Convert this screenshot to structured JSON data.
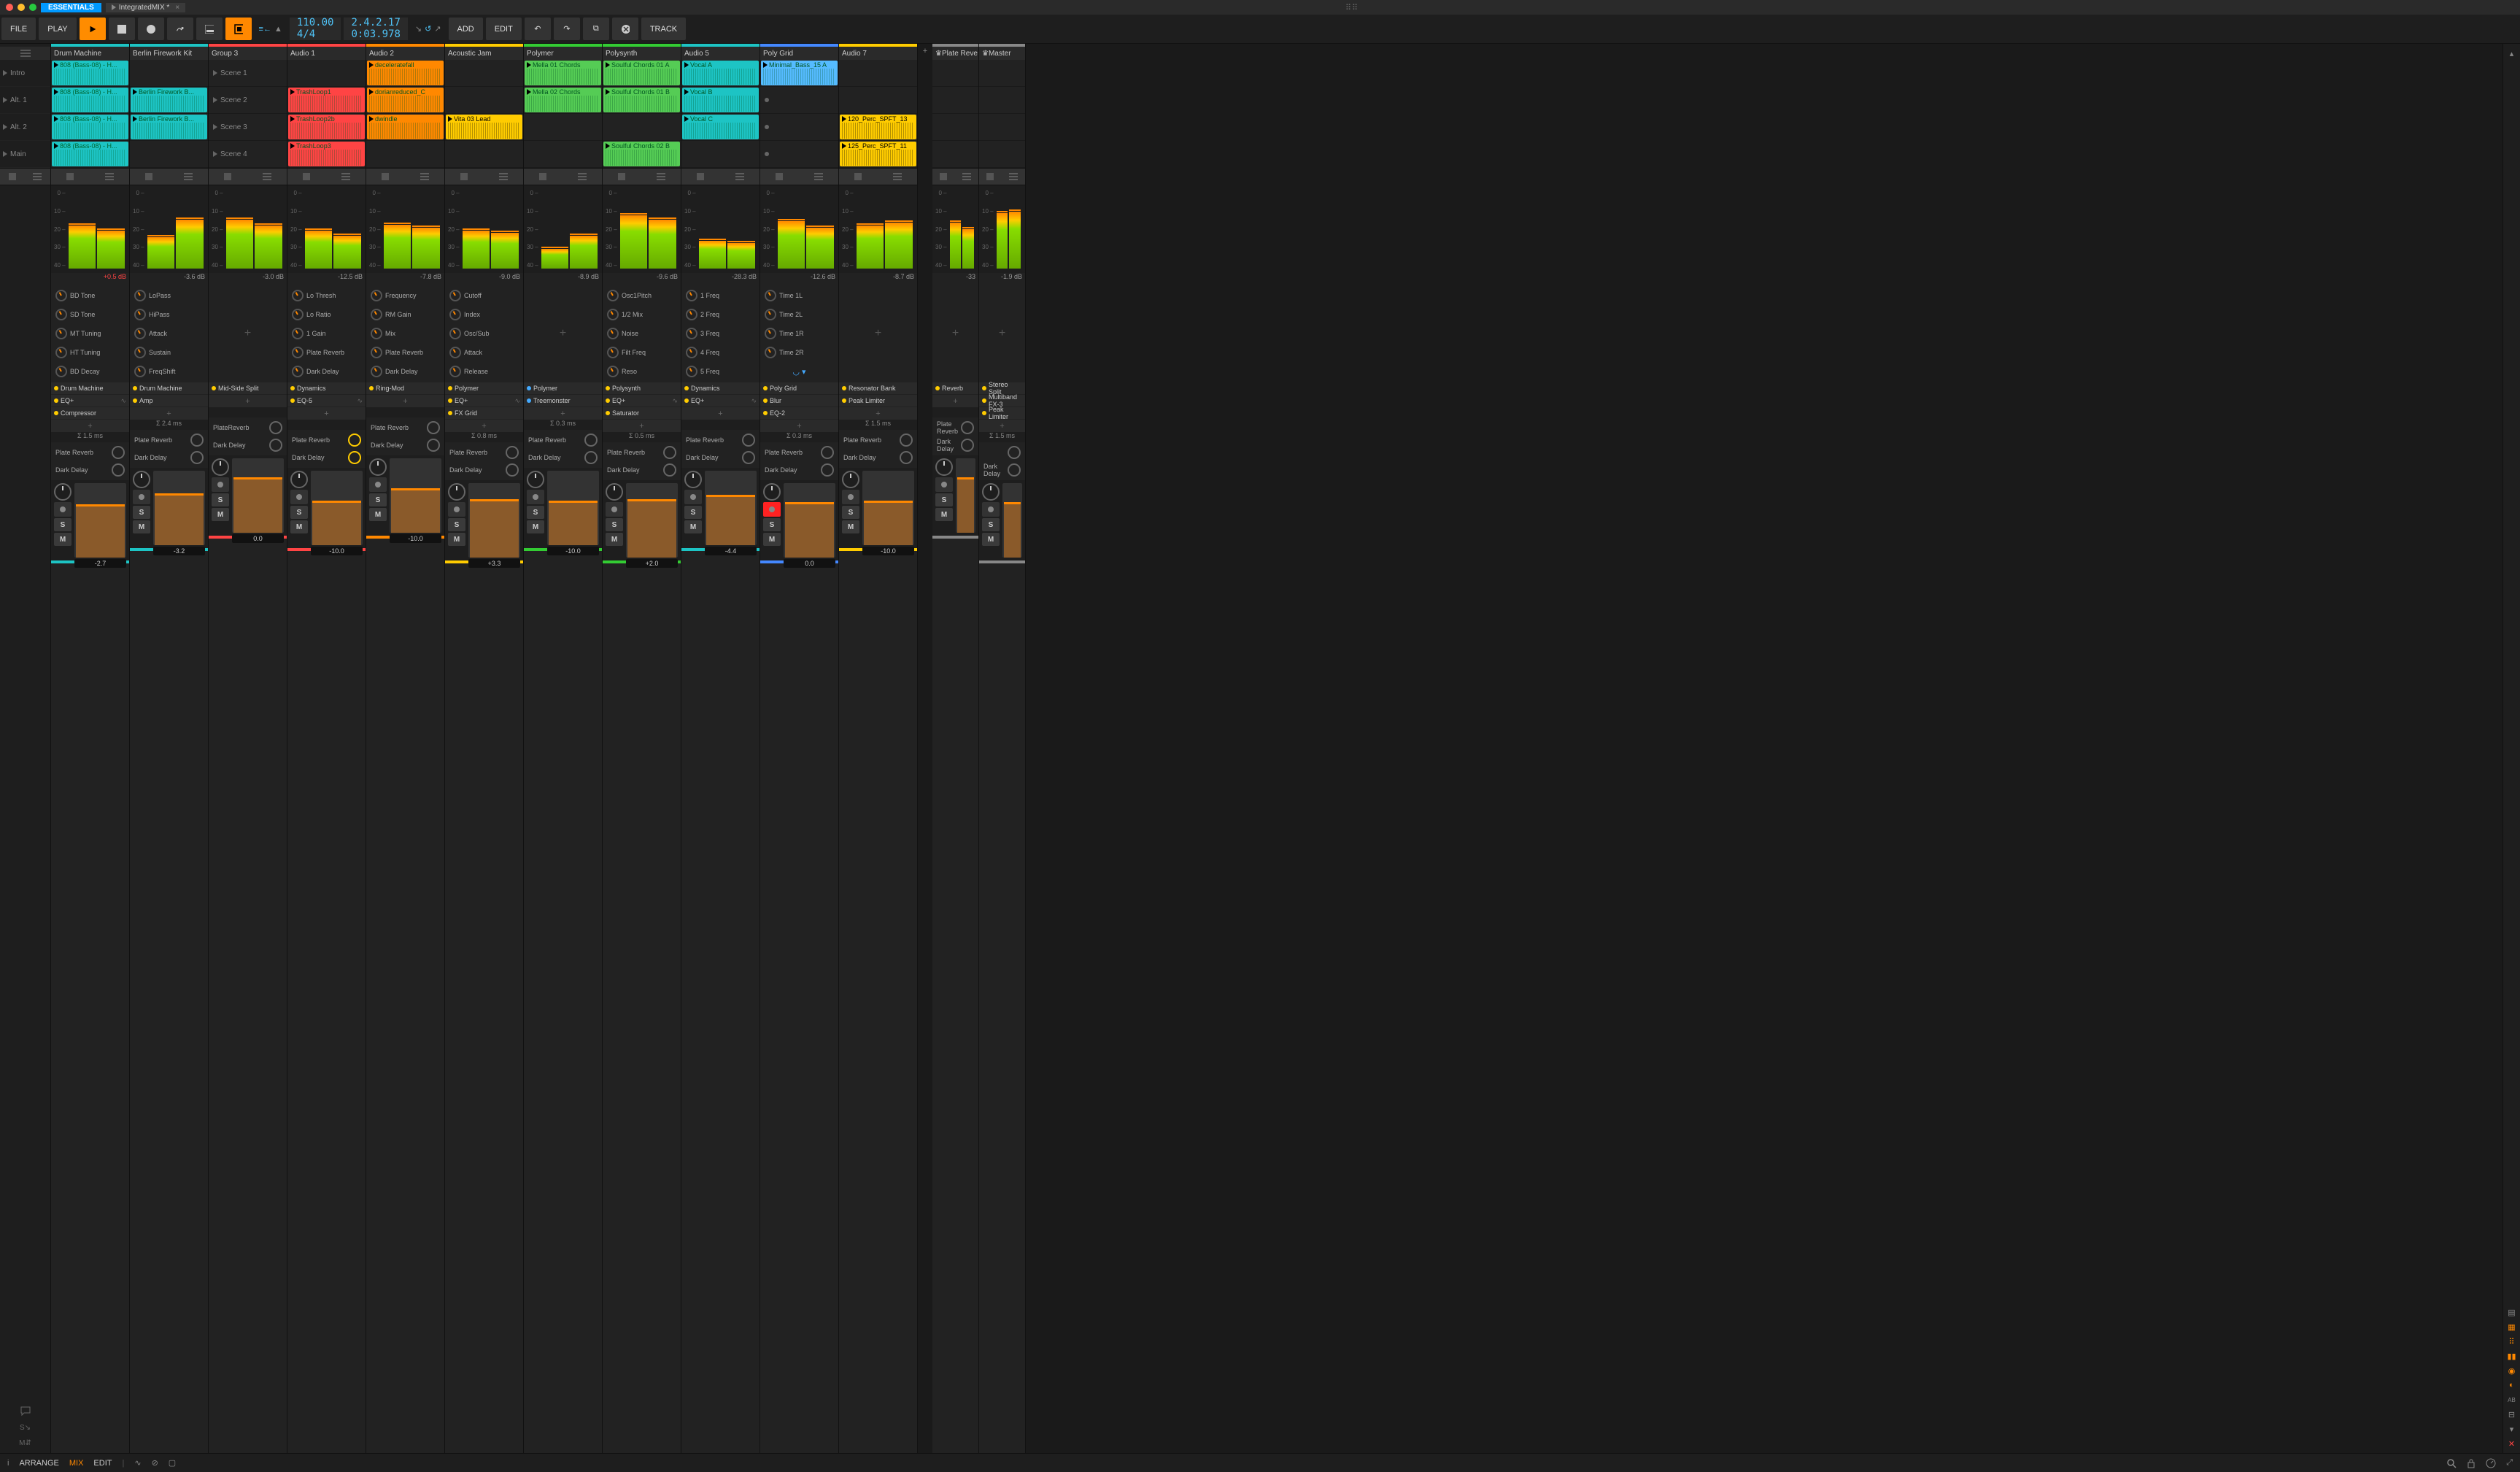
{
  "title_bar": {
    "app_tag": "ESSENTIALS",
    "doc": "IntegratedMIX *"
  },
  "toolbar": {
    "file": "FILE",
    "play": "PLAY",
    "add": "ADD",
    "edit": "EDIT",
    "track": "TRACK",
    "tempo": "110.00",
    "sig": "4/4",
    "pos": "2.4.2.17",
    "time": "0:03.978"
  },
  "scenes": [
    "Intro",
    "Alt. 1",
    "Alt. 2",
    "Main"
  ],
  "tracks": [
    {
      "name": "Drum Machine",
      "color": "#1dc4c4",
      "db": "+0.5 dB",
      "db_red": true,
      "meters": [
        55,
        48
      ],
      "clips": [
        {
          "label": "808 (Bass-08) - H...",
          "bg": "#1dc4c4",
          "fg": "#063"
        },
        {
          "label": "808 (Bass-08) - H...",
          "bg": "#1dc4c4",
          "fg": "#063"
        },
        {
          "label": "808 (Bass-08) - H...",
          "bg": "#1dc4c4",
          "fg": "#063"
        },
        {
          "label": "808 (Bass-08) - H...",
          "bg": "#1dc4c4",
          "fg": "#063"
        }
      ],
      "knobs": [
        "BD Tone",
        "SD Tone",
        "MT Tuning",
        "HT Tuning",
        "BD Decay"
      ],
      "devices": [
        {
          "n": "Drum Machine"
        },
        {
          "n": "EQ+",
          "w": true
        },
        {
          "n": "Compressor"
        }
      ],
      "latency": "Σ 1.5 ms",
      "sends": [
        "Plate Reverb",
        "Dark Delay"
      ],
      "send_on": [
        false,
        false
      ],
      "fader": 72,
      "val": "-2.7"
    },
    {
      "name": "Berlin Firework Kit",
      "color": "#1dc4c4",
      "db": "-3.6 dB",
      "meters": [
        40,
        62
      ],
      "clips": [
        null,
        {
          "label": "Berlin Firework B...",
          "bg": "#1dc4c4"
        },
        {
          "label": "Berlin Firework B...",
          "bg": "#1dc4c4"
        },
        null
      ],
      "knobs": [
        "LoPass",
        "HiPass",
        "Attack",
        "Sustain",
        "FreqShift"
      ],
      "devices": [
        {
          "n": "Drum Machine"
        },
        {
          "n": "Amp"
        }
      ],
      "add_dev": true,
      "latency": "Σ 2.4 ms",
      "sends": [
        "Plate Reverb",
        "Dark Delay"
      ],
      "send_on": [
        false,
        false
      ],
      "fader": 70,
      "val": "-3.2"
    },
    {
      "name": "Group 3",
      "color": "#f44",
      "db": "-3.0 dB",
      "is_group": true,
      "meters": [
        62,
        55
      ],
      "scene_labels": [
        "Scene 1",
        "Scene 2",
        "Scene 3",
        "Scene 4"
      ],
      "knobs": [],
      "devices": [
        {
          "n": "Mid-Side Split"
        }
      ],
      "add_dev": true,
      "sends": [
        "PlateReverb",
        "Dark Delay"
      ],
      "send_on": [
        false,
        false
      ],
      "fader": 75,
      "val": "0.0"
    },
    {
      "name": "Audio 1",
      "color": "#f44",
      "db": "-12.5 dB",
      "meters": [
        48,
        42
      ],
      "clips": [
        null,
        {
          "label": "TrashLoop1",
          "bg": "#f44"
        },
        {
          "label": "TrashLoop2b",
          "bg": "#f44"
        },
        {
          "label": "TrashLoop3",
          "bg": "#f44"
        }
      ],
      "knobs": [
        "Lo Thresh",
        "Lo Ratio",
        "1 Gain",
        "Plate Reverb",
        "Dark Delay"
      ],
      "devices": [
        {
          "n": "Dynamics"
        },
        {
          "n": "EQ-5",
          "w": true
        }
      ],
      "add_dev": true,
      "sends": [
        "Plate Reverb",
        "Dark Delay"
      ],
      "send_on": [
        true,
        true
      ],
      "fader": 60,
      "val": "-10.0"
    },
    {
      "name": "Audio 2",
      "color": "#f80",
      "db": "-7.8 dB",
      "meters": [
        56,
        52
      ],
      "clips": [
        {
          "label": "deceleratefall",
          "bg": "#f80"
        },
        {
          "label": "dorianreduced_C",
          "bg": "#f80"
        },
        {
          "label": "dwindle",
          "bg": "#f80"
        },
        null
      ],
      "knobs": [
        "Frequency",
        "RM Gain",
        "Mix",
        "Plate Reverb",
        "Dark Delay"
      ],
      "devices": [
        {
          "n": "Ring-Mod"
        }
      ],
      "add_dev": true,
      "sends": [
        "Plate Reverb",
        "Dark Delay"
      ],
      "send_on": [
        false,
        false
      ],
      "fader": 60,
      "val": "-10.0"
    },
    {
      "name": "Acoustic Jam",
      "color": "#fc0",
      "db": "-9.0 dB",
      "meters": [
        48,
        45
      ],
      "clips": [
        null,
        null,
        {
          "label": "Vita 03 Lead",
          "bg": "#fc0",
          "fg": "#000"
        },
        null
      ],
      "knobs": [
        "Cutoff",
        "Index",
        "Osc/Sub",
        "Attack",
        "Release"
      ],
      "devices": [
        {
          "n": "Polymer"
        },
        {
          "n": "EQ+",
          "w": true
        },
        {
          "n": "FX Grid"
        }
      ],
      "add_dev": true,
      "latency": "Σ 0.8 ms",
      "sends": [
        "Plate Reverb",
        "Dark Delay"
      ],
      "send_on": [
        false,
        false
      ],
      "fader": 78,
      "val": "+3.3"
    },
    {
      "name": "Polymer",
      "color": "#3c3",
      "db": "-8.9 dB",
      "meters": [
        25,
        42
      ],
      "clips": [
        {
          "label": "Mella 01 Chords",
          "bg": "#5c5"
        },
        {
          "label": "Mella 02 Chords",
          "bg": "#5c5"
        },
        null,
        null
      ],
      "knobs": [],
      "devices": [
        {
          "n": "Polymer",
          "moon": true
        },
        {
          "n": "Treemonster",
          "moon": true
        }
      ],
      "add_dev": true,
      "latency": "Σ 0.3 ms",
      "sends": [
        "Plate Reverb",
        "Dark Delay"
      ],
      "send_on": [
        false,
        false
      ],
      "fader": 60,
      "val": "-10.0"
    },
    {
      "name": "Polysynth",
      "color": "#3c3",
      "db": "-9.6 dB",
      "meters": [
        68,
        62
      ],
      "clips": [
        {
          "label": "Soulful Chords 01 A",
          "bg": "#5c5"
        },
        {
          "label": "Soulful Chords 01 B",
          "bg": "#5c5"
        },
        null,
        {
          "label": "Soulful Chords 02 B",
          "bg": "#5c5"
        }
      ],
      "knobs": [
        "Osc1Pitch",
        "1/2 Mix",
        "Noise",
        "Filt Freq",
        "Reso"
      ],
      "devices": [
        {
          "n": "Polysynth"
        },
        {
          "n": "EQ+",
          "w": true
        },
        {
          "n": "Saturator"
        }
      ],
      "add_dev": true,
      "latency": "Σ 0.5 ms",
      "sends": [
        "Plate Reverb",
        "Dark Delay"
      ],
      "send_on": [
        false,
        false
      ],
      "fader": 78,
      "val": "+2.0"
    },
    {
      "name": "Audio 5",
      "color": "#1dc4c4",
      "db": "-28.3 dB",
      "meters": [
        35,
        32
      ],
      "clips": [
        {
          "label": "Vocal A",
          "bg": "#1dc4c4"
        },
        {
          "label": "Vocal B",
          "bg": "#1dc4c4"
        },
        {
          "label": "Vocal C",
          "bg": "#1dc4c4"
        },
        null
      ],
      "knobs": [
        "1 Freq",
        "2 Freq",
        "3 Freq",
        "4 Freq",
        "5 Freq"
      ],
      "devices": [
        {
          "n": "Dynamics"
        },
        {
          "n": "EQ+",
          "w": true
        }
      ],
      "add_dev": true,
      "sends": [
        "Plate Reverb",
        "Dark Delay"
      ],
      "send_on": [
        false,
        false
      ],
      "fader": 68,
      "val": "-4.4"
    },
    {
      "name": "Poly Grid",
      "color": "#48f",
      "db": "-12.6 dB",
      "meters": [
        60,
        52
      ],
      "clips": [
        {
          "label": "Minimal_Bass_15 A",
          "bg": "#5bf"
        }
      ],
      "clip_dots": [
        null,
        true,
        true,
        true
      ],
      "knobs": [
        "Time 1L",
        "Time 2L",
        "Time 1R",
        "Time 2R"
      ],
      "wifi": true,
      "devices": [
        {
          "n": "Poly Grid"
        },
        {
          "n": "Blur"
        },
        {
          "n": "EQ-2"
        }
      ],
      "add_dev": true,
      "latency": "Σ 0.3 ms",
      "sends": [
        "Plate Reverb",
        "Dark Delay"
      ],
      "send_on": [
        false,
        false
      ],
      "fader": 75,
      "val": "0.0",
      "rec_armed": true
    },
    {
      "name": "Audio 7",
      "color": "#fc0",
      "db": "-8.7 dB",
      "meters": [
        55,
        58
      ],
      "clips": [
        null,
        null,
        {
          "label": "120_Perc_SPFT_13",
          "bg": "#fc0",
          "fg": "#000"
        },
        {
          "label": "125_Perc_SPFT_11",
          "bg": "#fc0",
          "fg": "#000"
        }
      ],
      "knobs": [],
      "devices": [
        {
          "n": "Resonator Bank"
        },
        {
          "n": "Peak Limiter"
        }
      ],
      "add_dev": true,
      "latency": "Σ 1.5 ms",
      "sends": [
        "Plate Reverb",
        "Dark Delay"
      ],
      "send_on": [
        false,
        false
      ],
      "fader": 60,
      "val": "-10.0"
    }
  ],
  "fx_tracks": [
    {
      "name": "Plate Reve",
      "color": "#888",
      "db": "-33",
      "meters": [
        58,
        50
      ],
      "devices": [
        {
          "n": "Reverb"
        }
      ],
      "sends": [
        "Plate Reverb",
        "Dark Delay"
      ],
      "fader": 75,
      "no_val": true
    },
    {
      "name": "Master",
      "color": "#888",
      "db": "-1.9 dB",
      "meters": [
        70,
        72
      ],
      "devices": [
        {
          "n": "Stereo Split"
        },
        {
          "n": "Multiband FX-3"
        },
        {
          "n": "Peak Limiter"
        }
      ],
      "latency": "Σ 1.5 ms",
      "sends": [
        "",
        "Dark Delay"
      ],
      "fader": 75,
      "no_val": true
    }
  ],
  "meter_scale": [
    "0",
    "10",
    "20",
    "30",
    "40"
  ],
  "bottom": {
    "arrange": "ARRANGE",
    "mix": "MIX",
    "edit": "EDIT"
  }
}
